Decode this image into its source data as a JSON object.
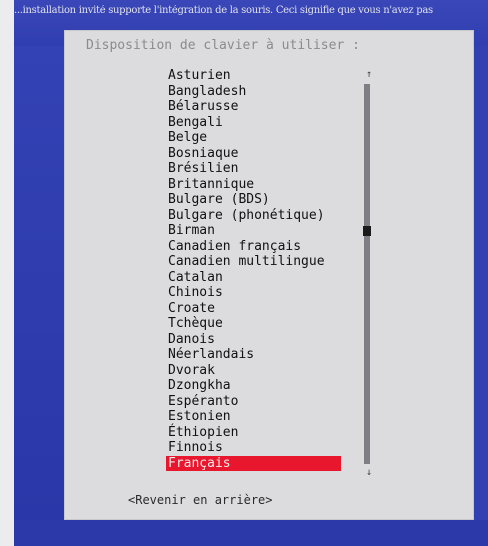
{
  "screen": {
    "help_text": "...installation invité supporte l'intégration de la souris. Ceci signifie que vous n'avez pas"
  },
  "dialog": {
    "title": "Disposition de clavier à utiliser :",
    "items": [
      "Asturien",
      "Bangladesh",
      "Bélarusse",
      "Bengali",
      "Belge",
      "Bosniaque",
      "Brésilien",
      "Britannique",
      "Bulgare (BDS)",
      "Bulgare (phonétique)",
      "Birman",
      "Canadien français",
      "Canadien multilingue",
      "Catalan",
      "Chinois",
      "Croate",
      "Tchèque",
      "Danois",
      "Néerlandais",
      "Dvorak",
      "Dzongkha",
      "Espéranto",
      "Estonien",
      "Éthiopien",
      "Finnois",
      "Français"
    ],
    "selected_index": 25,
    "scroll_up_glyph": "↑",
    "scroll_down_glyph": "↓",
    "back_label": "<Revenir en arrière>"
  },
  "colors": {
    "selection": "#e8172d",
    "background": "#3a47b8"
  }
}
